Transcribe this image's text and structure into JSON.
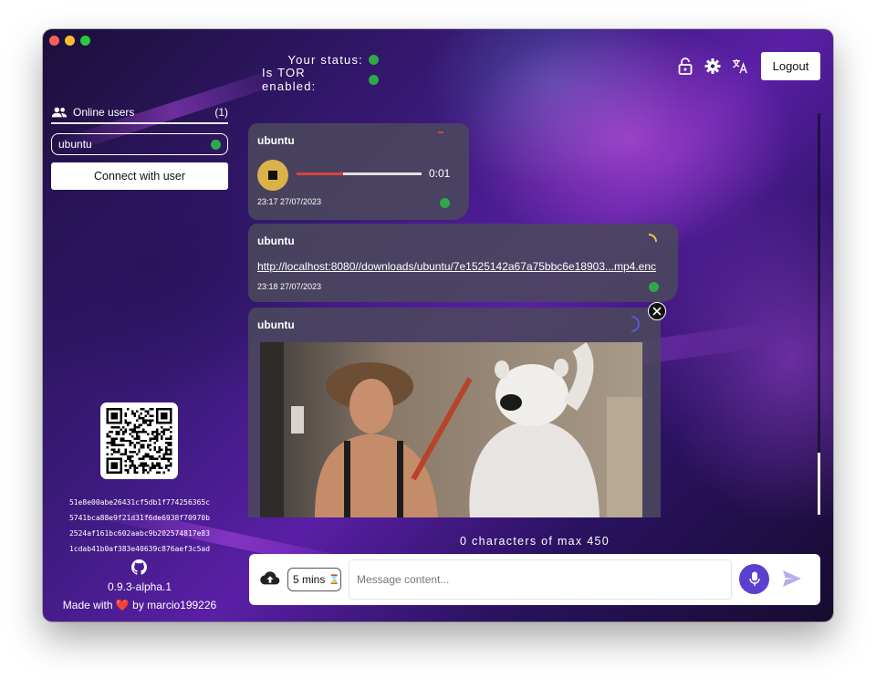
{
  "header": {
    "status_label": "Your status:",
    "tor_label": "Is TOR enabled:",
    "status_color": "#2fa84a",
    "icons": [
      "lock-open-icon",
      "gear-icon",
      "translate-icon"
    ],
    "logout_label": "Logout"
  },
  "sidebar": {
    "online_users_label": "Online users",
    "online_count": "(1)",
    "users": [
      {
        "name": "ubuntu",
        "status_color": "#2fa84a"
      }
    ],
    "connect_label": "Connect with user",
    "fingerprint": [
      "51e8e00abe26431cf5db1f774256365c",
      "5741bca88e9f21d31f6de6938f70970b",
      "2524af161bc602aabc9b202574817e83",
      "1cdab41b0af383e40639c876aef3c5ad"
    ],
    "version": "0.9.3-alpha.1",
    "made_with_prefix": "Made with",
    "made_with_heart": "❤️",
    "made_with_suffix": "by marcio199226"
  },
  "messages": [
    {
      "author": "ubuntu",
      "type": "audio",
      "duration": "0:01",
      "progress": 0.37,
      "timestamp": "23:17 27/07/2023"
    },
    {
      "author": "ubuntu",
      "type": "file",
      "link": "http://localhost:8080//downloads/ubuntu/7e1525142a67a75bbc6e18903...mp4.enc",
      "timestamp": "23:18 27/07/2023"
    },
    {
      "author": "ubuntu",
      "type": "video"
    }
  ],
  "composer": {
    "char_count": "0 characters of max 450",
    "timer_value": "5 mins",
    "placeholder": "Message content..."
  }
}
